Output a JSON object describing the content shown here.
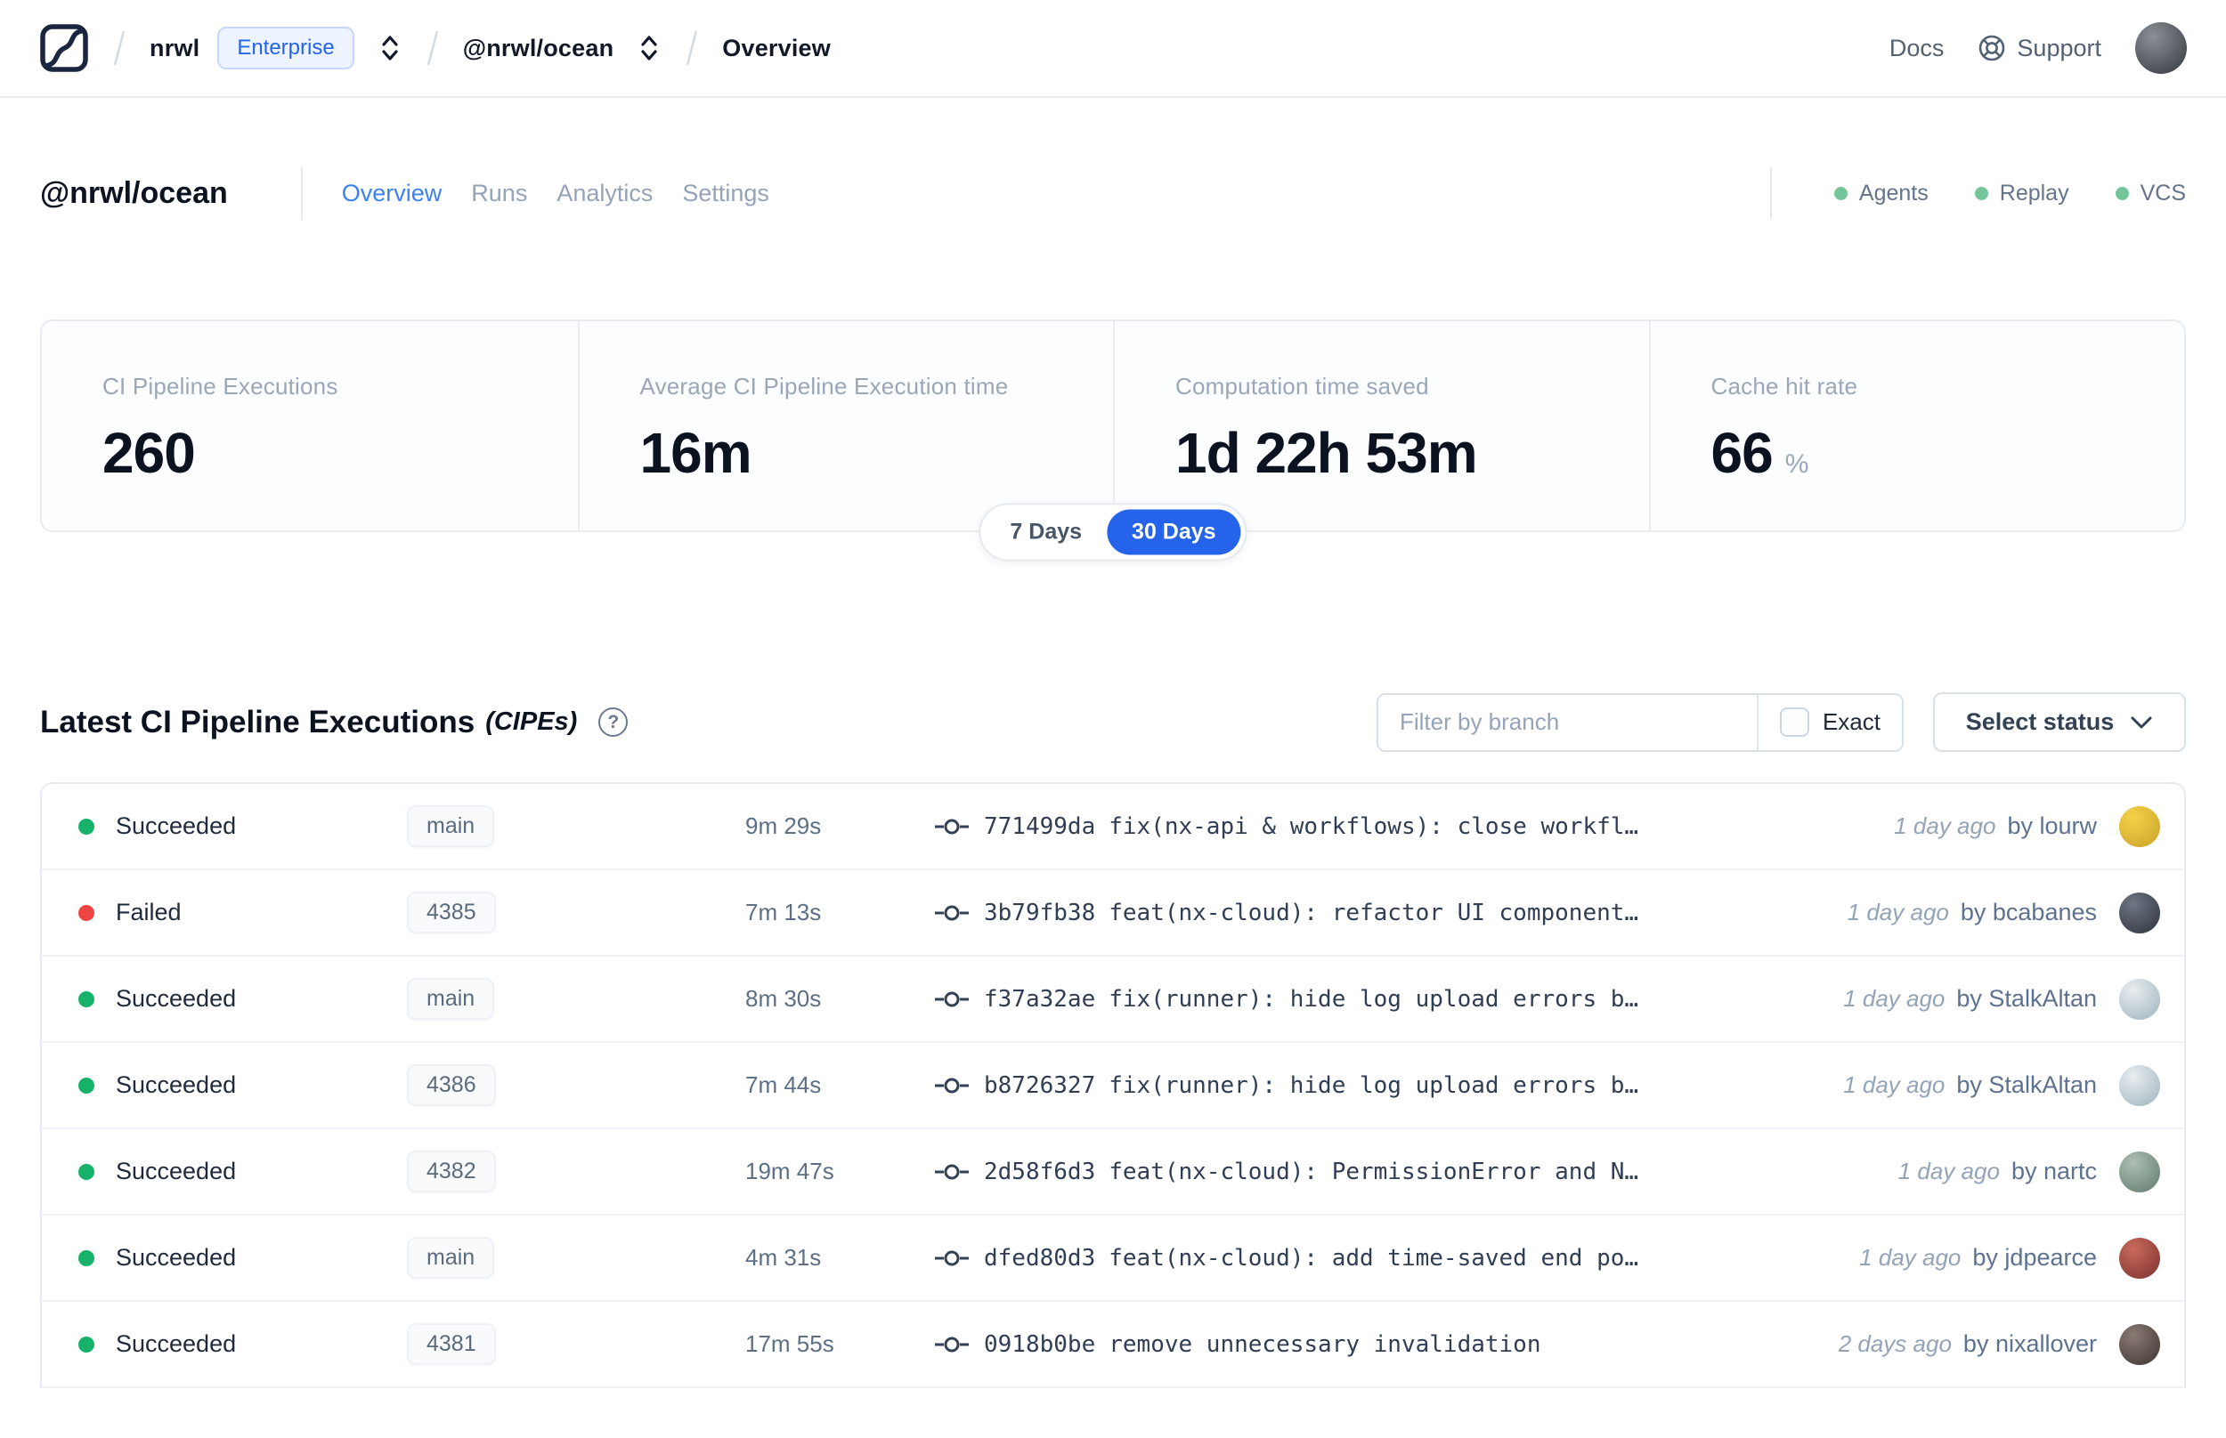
{
  "navbar": {
    "logo_name": "nx-cloud-logo",
    "breadcrumb": {
      "org": "nrwl",
      "org_badge": "Enterprise",
      "workspace": "@nrwl/ocean",
      "page": "Overview"
    },
    "docs_label": "Docs",
    "support_label": "Support",
    "avatar_colors": [
      "#8b8f96",
      "#33373e"
    ]
  },
  "header": {
    "title": "@nrwl/ocean",
    "tabs": [
      {
        "label": "Overview",
        "active": true
      },
      {
        "label": "Runs",
        "active": false
      },
      {
        "label": "Analytics",
        "active": false
      },
      {
        "label": "Settings",
        "active": false
      }
    ],
    "env_badges": [
      {
        "label": "Agents"
      },
      {
        "label": "Replay"
      },
      {
        "label": "VCS"
      }
    ]
  },
  "stats": {
    "cards": [
      {
        "label": "CI Pipeline Executions",
        "value": "260",
        "unit": ""
      },
      {
        "label": "Average CI Pipeline Execution time",
        "value": "16m",
        "unit": ""
      },
      {
        "label": "Computation time saved",
        "value": "1d 22h 53m",
        "unit": ""
      },
      {
        "label": "Cache hit rate",
        "value": "66",
        "unit": "%"
      }
    ],
    "range_toggle": {
      "options": [
        "7 Days",
        "30 Days"
      ],
      "selected": "30 Days"
    }
  },
  "cipe_section": {
    "title": "Latest CI Pipeline Executions",
    "title_suffix": "(CIPEs)",
    "help_icon": "question-circle",
    "filter_placeholder": "Filter by branch",
    "exact_label": "Exact",
    "exact_checked": false,
    "status_select_label": "Select status",
    "rows": [
      {
        "status": "Succeeded",
        "branch": "main",
        "duration": "9m 29s",
        "commit_hash": "771499da",
        "commit_message": "fix(nx-api & workflows): close workfl…",
        "time_ago": "1 day ago",
        "author": "by lourw",
        "avatar_colors": [
          "#f6d14a",
          "#c9a227"
        ]
      },
      {
        "status": "Failed",
        "branch": "4385",
        "duration": "7m 13s",
        "commit_hash": "3b79fb38",
        "commit_message": "feat(nx-cloud): refactor UI component…",
        "time_ago": "1 day ago",
        "author": "by bcabanes",
        "avatar_colors": [
          "#6d7683",
          "#2e333b"
        ]
      },
      {
        "status": "Succeeded",
        "branch": "main",
        "duration": "8m 30s",
        "commit_hash": "f37a32ae",
        "commit_message": "fix(runner): hide log upload errors b…",
        "time_ago": "1 day ago",
        "author": "by StalkAltan",
        "avatar_colors": [
          "#e8edf0",
          "#9fb3bd"
        ]
      },
      {
        "status": "Succeeded",
        "branch": "4386",
        "duration": "7m 44s",
        "commit_hash": "b8726327",
        "commit_message": "fix(runner): hide log upload errors b…",
        "time_ago": "1 day ago",
        "author": "by StalkAltan",
        "avatar_colors": [
          "#e8edf0",
          "#9fb3bd"
        ]
      },
      {
        "status": "Succeeded",
        "branch": "4382",
        "duration": "19m 47s",
        "commit_hash": "2d58f6d3",
        "commit_message": "feat(nx-cloud): PermissionError and N…",
        "time_ago": "1 day ago",
        "author": "by nartc",
        "avatar_colors": [
          "#aebfb4",
          "#5e7a6c"
        ]
      },
      {
        "status": "Succeeded",
        "branch": "main",
        "duration": "4m 31s",
        "commit_hash": "dfed80d3",
        "commit_message": "feat(nx-cloud): add time-saved end po…",
        "time_ago": "1 day ago",
        "author": "by jdpearce",
        "avatar_colors": [
          "#c96a5a",
          "#7c3030"
        ]
      },
      {
        "status": "Succeeded",
        "branch": "4381",
        "duration": "17m 55s",
        "commit_hash": "0918b0be",
        "commit_message": "remove unnecessary invalidation",
        "time_ago": "2 days ago",
        "author": "by nixallover",
        "avatar_colors": [
          "#8a7a74",
          "#3c3431"
        ]
      }
    ]
  },
  "colors": {
    "accent_blue": "#3b82f6",
    "toggle_blue": "#2563eb",
    "status_success": "#17b26a",
    "status_failed": "#ef4444",
    "env_dot_green": "#74c69a"
  }
}
